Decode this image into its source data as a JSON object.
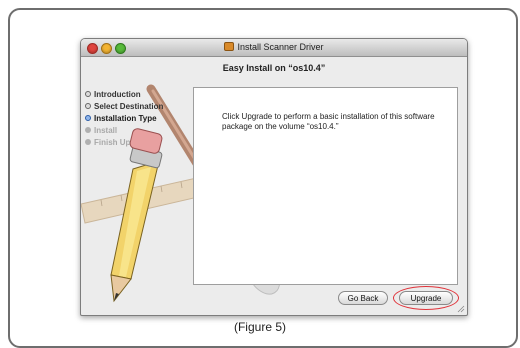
{
  "window": {
    "title": "Install Scanner Driver",
    "heading": "Easy Install on “os10.4”"
  },
  "sidebar": {
    "steps": [
      {
        "label": "Introduction",
        "state": "done"
      },
      {
        "label": "Select Destination",
        "state": "done"
      },
      {
        "label": "Installation Type",
        "state": "current"
      },
      {
        "label": "Install",
        "state": "pending"
      },
      {
        "label": "Finish Up",
        "state": "pending"
      }
    ]
  },
  "content": {
    "message": "Click Upgrade to perform a basic installation of this software package on the volume “os10.4.”"
  },
  "buttons": {
    "go_back": "Go Back",
    "upgrade": "Upgrade"
  },
  "caption": "(Figure 5)",
  "colors": {
    "highlight": "#e0333a",
    "current_step": "#2c5da8"
  }
}
